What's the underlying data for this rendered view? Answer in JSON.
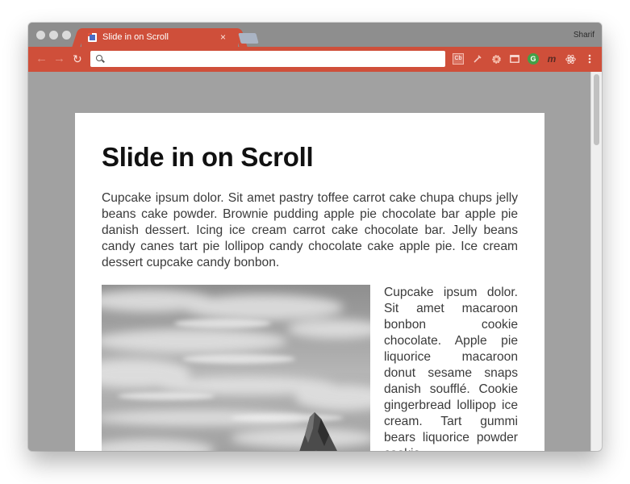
{
  "window": {
    "tab_title": "Slide in on Scroll",
    "tab_close": "×",
    "user_name": "Sharif",
    "accent_color": "#cf4f3a"
  },
  "toolbar": {
    "back_icon": "←",
    "forward_icon": "→",
    "reload_icon": "↻",
    "address_value": "",
    "extension_icons": [
      "cb-extension-icon",
      "eyedropper-icon",
      "gear-extension-icon",
      "window-icon",
      "grammarly-icon",
      "m-extension-icon",
      "react-devtools-icon",
      "more-menu-icon"
    ]
  },
  "page": {
    "title": "Slide in on Scroll",
    "intro": "Cupcake ipsum dolor. Sit amet pastry toffee carrot cake chupa chups jelly beans cake powder. Brownie pudding apple pie chocolate bar apple pie danish dessert. Icing ice cream carrot cake chocolate bar. Jelly beans candy canes tart pie lollipop candy chocolate cake apple pie. Ice cream dessert cupcake candy bonbon.",
    "side_text": "Cupcake ipsum dolor. Sit amet macaroon bonbon cookie chocolate. Apple pie liquorice macaroon donut sesame snaps danish soufflé. Cookie gingerbread lollipop ice cream. Tart gummi bears liquorice powder cookie."
  }
}
